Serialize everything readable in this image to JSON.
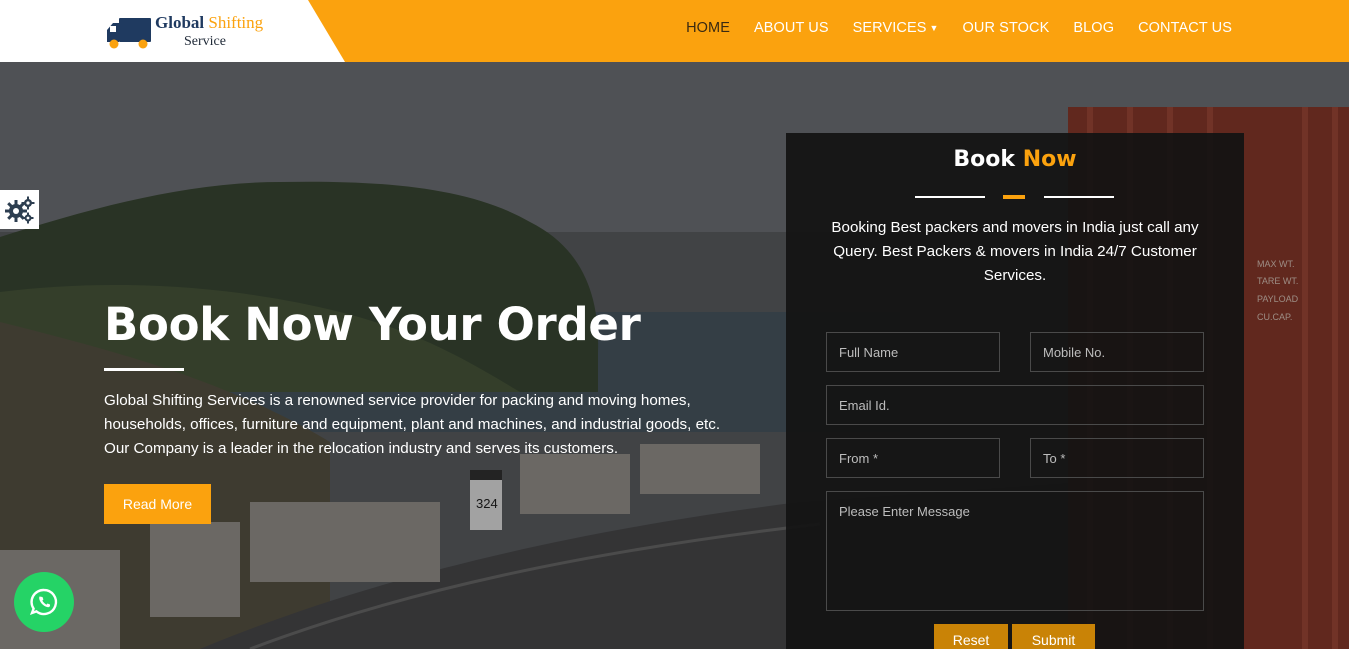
{
  "brand": {
    "logo_word1": "Global",
    "logo_word2": "Shifting",
    "logo_word3": "Service"
  },
  "nav": {
    "items": [
      {
        "label": "HOME"
      },
      {
        "label": "ABOUT US"
      },
      {
        "label": "SERVICES"
      },
      {
        "label": "OUR STOCK"
      },
      {
        "label": "BLOG"
      },
      {
        "label": "CONTACT US"
      }
    ]
  },
  "hero": {
    "title": "Book Now Your Order",
    "description": "Global Shifting Services is a renowned service provider for packing and moving homes, households, offices, furniture and equipment, plant and machines, and industrial goods, etc. Our Company is a leader in the relocation industry and serves its customers.",
    "read_more_label": "Read More"
  },
  "booking": {
    "title_main": "Book",
    "title_accent": "Now",
    "description": "Booking Best packers and movers in India just call any Query. Best Packers & movers in India 24/7 Customer Services.",
    "fields": {
      "full_name": "Full Name",
      "mobile": "Mobile No.",
      "email": "Email Id.",
      "from": "From *",
      "to": "To *",
      "message": "Please Enter Message"
    },
    "reset_label": "Reset",
    "submit_label": "Submit"
  },
  "background_text": {
    "road_sign": "324",
    "container_label1": "MAX WT.",
    "container_label2": "TARE WT.",
    "container_label3": "PAYLOAD",
    "container_label4": "CU.CAP."
  },
  "colors": {
    "accent": "#fba20e",
    "header_bg": "#fba20e",
    "panel_bg": "#121212",
    "whatsapp": "#25d366",
    "logo_navy": "#1f3a60"
  },
  "icons": [
    "truck-logo-icon",
    "gear-icon",
    "chevron-down-icon",
    "whatsapp-icon"
  ]
}
